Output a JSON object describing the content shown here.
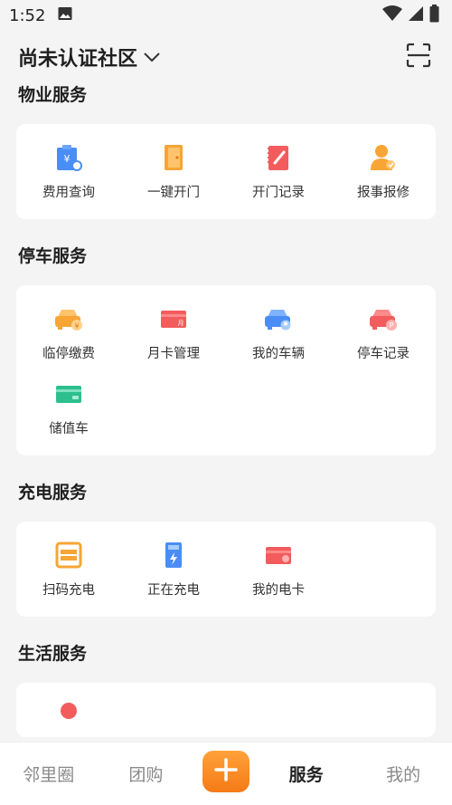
{
  "status": {
    "time": "1:52"
  },
  "header": {
    "community": "尚未认证社区"
  },
  "sections": [
    {
      "title": "物业服务",
      "items": [
        {
          "label": "费用查询",
          "icon": "fee-query-icon"
        },
        {
          "label": "一键开门",
          "icon": "door-open-icon"
        },
        {
          "label": "开门记录",
          "icon": "door-record-icon"
        },
        {
          "label": "报事报修",
          "icon": "repair-report-icon"
        }
      ]
    },
    {
      "title": "停车服务",
      "items": [
        {
          "label": "临停缴费",
          "icon": "temp-parking-fee-icon"
        },
        {
          "label": "月卡管理",
          "icon": "monthly-card-icon"
        },
        {
          "label": "我的车辆",
          "icon": "my-vehicle-icon"
        },
        {
          "label": "停车记录",
          "icon": "parking-record-icon"
        },
        {
          "label": "储值车",
          "icon": "stored-value-car-icon"
        }
      ]
    },
    {
      "title": "充电服务",
      "items": [
        {
          "label": "扫码充电",
          "icon": "scan-charge-icon"
        },
        {
          "label": "正在充电",
          "icon": "charging-icon"
        },
        {
          "label": "我的电卡",
          "icon": "charge-card-icon"
        }
      ]
    },
    {
      "title": "生活服务",
      "items": []
    }
  ],
  "nav": {
    "items": [
      "邻里圈",
      "团购",
      "服务",
      "我的"
    ],
    "active": "服务"
  }
}
